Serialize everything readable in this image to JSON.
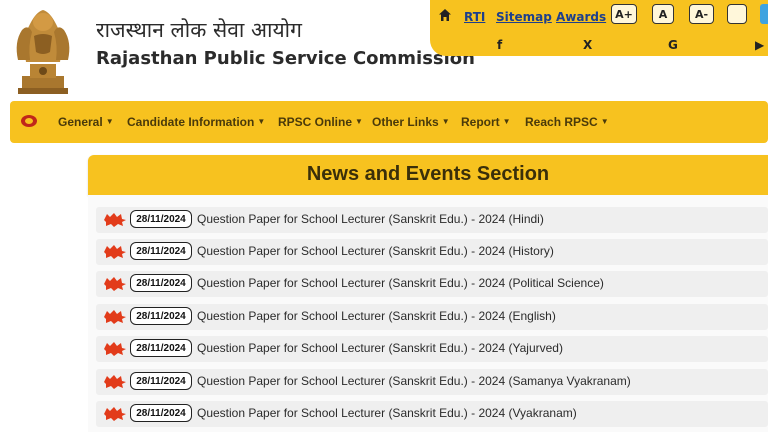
{
  "header": {
    "title_hindi": "राजस्थान लोक सेवा आयोग",
    "title_english": "Rajasthan Public Service Commission",
    "emblem_icon": "state-emblem-icon"
  },
  "topbar": {
    "home_icon": "home-icon",
    "links": [
      "RTI",
      "Sitemap",
      "Awards"
    ],
    "font_buttons": [
      "A+",
      "A",
      "A-"
    ],
    "social_icons": [
      "facebook-icon",
      "x-twitter-icon",
      "google-icon",
      "youtube-icon"
    ],
    "social_glyphs": [
      "f",
      "X",
      "G",
      "▶"
    ]
  },
  "navbar": {
    "items": [
      "General",
      "Candidate Information",
      "RPSC Online",
      "Other Links",
      "Report",
      "Reach RPSC"
    ]
  },
  "news": {
    "title": "News and Events Section",
    "items": [
      {
        "date": "28/11/2024",
        "text": "Question Paper for School Lecturer (Sanskrit Edu.) - 2024 (Hindi)"
      },
      {
        "date": "28/11/2024",
        "text": "Question Paper for School Lecturer (Sanskrit Edu.) - 2024 (History)"
      },
      {
        "date": "28/11/2024",
        "text": "Question Paper for School Lecturer (Sanskrit Edu.) - 2024 (Political Science)"
      },
      {
        "date": "28/11/2024",
        "text": "Question Paper for School Lecturer (Sanskrit Edu.) - 2024 (English)"
      },
      {
        "date": "28/11/2024",
        "text": "Question Paper for School Lecturer (Sanskrit Edu.) - 2024 (Yajurved)"
      },
      {
        "date": "28/11/2024",
        "text": "Question Paper for School Lecturer (Sanskrit Edu.) - 2024 (Samanya Vyakranam)"
      },
      {
        "date": "28/11/2024",
        "text": "Question Paper for School Lecturer (Sanskrit Edu.) - 2024 (Vyakranam)"
      }
    ]
  },
  "colors": {
    "brand_yellow": "#f7c21f",
    "link_blue": "#1d3f8c",
    "badge_red": "#e23b1a"
  }
}
